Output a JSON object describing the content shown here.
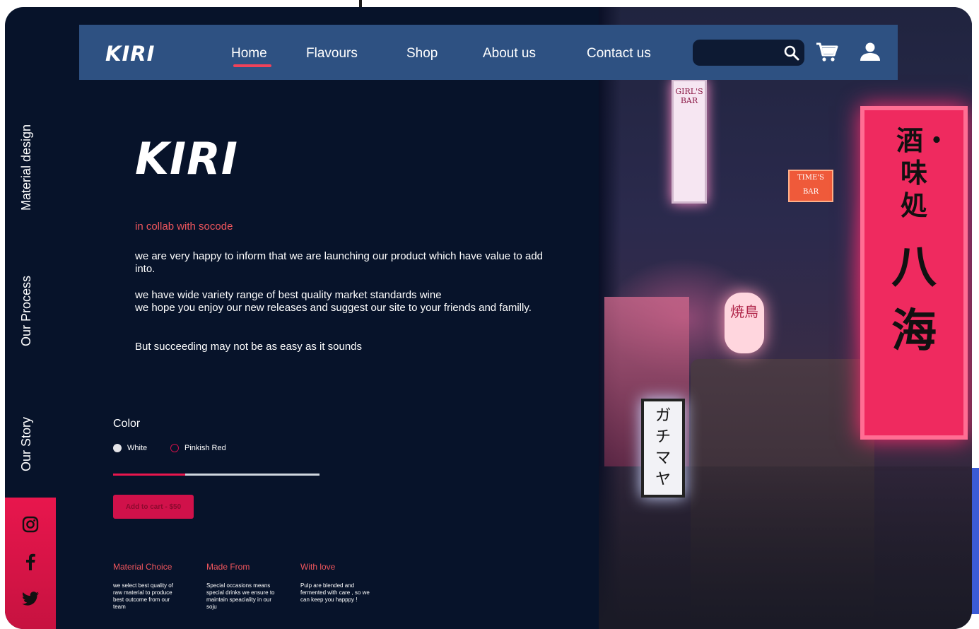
{
  "nav": {
    "logo": "KIRI",
    "links": [
      "Home",
      "Flavours",
      "Shop",
      "About us",
      "Contact us"
    ],
    "active": "Home",
    "search_placeholder": "",
    "icons": [
      "search-icon",
      "cart-icon",
      "user-icon"
    ]
  },
  "sidebar": {
    "items": [
      "Material design",
      "Our Process",
      "Our Story"
    ],
    "social": [
      "instagram-icon",
      "facebook-icon",
      "twitter-icon"
    ]
  },
  "hero": {
    "title": "KIRI",
    "collab": "in collab with socode",
    "paragraphs": [
      "we are very happy to inform that we are launching our product which have value to add into.",
      "we have wide variety range of best quality market standards wine\nwe hope you enjoy our new releases and suggest our site to your friends and familly.",
      "But succeeding may not be as easy as it sounds"
    ]
  },
  "product": {
    "color_label": "Color",
    "options": [
      "White",
      "Pinkish Red"
    ],
    "selected": "White",
    "slider_fraction": 0.35,
    "cart_button": "Add to cart - $50"
  },
  "features": [
    {
      "title": "Material Choice",
      "text": "we select best quality of raw material to produce best outcome from our team"
    },
    {
      "title": "Made From",
      "text": "Special occasions means special drinks we ensure to maintain speaciality in our soju"
    },
    {
      "title": "With love",
      "text": "Pulp are blended and fermented with care , so we can keep you happpy !"
    }
  ],
  "photo": {
    "white_sign": "GIRL'S BAR",
    "times_sign": "TIME'S BAR",
    "lantern": "焼鳥",
    "lightbox": "ガチマヤ",
    "red_sign_top": "酒・味処",
    "red_sign_bottom": "八 海"
  },
  "colors": {
    "background": "#07132a",
    "navbar": "#2e5182",
    "accent": "#e8164d",
    "collab_text": "#f0565d"
  }
}
